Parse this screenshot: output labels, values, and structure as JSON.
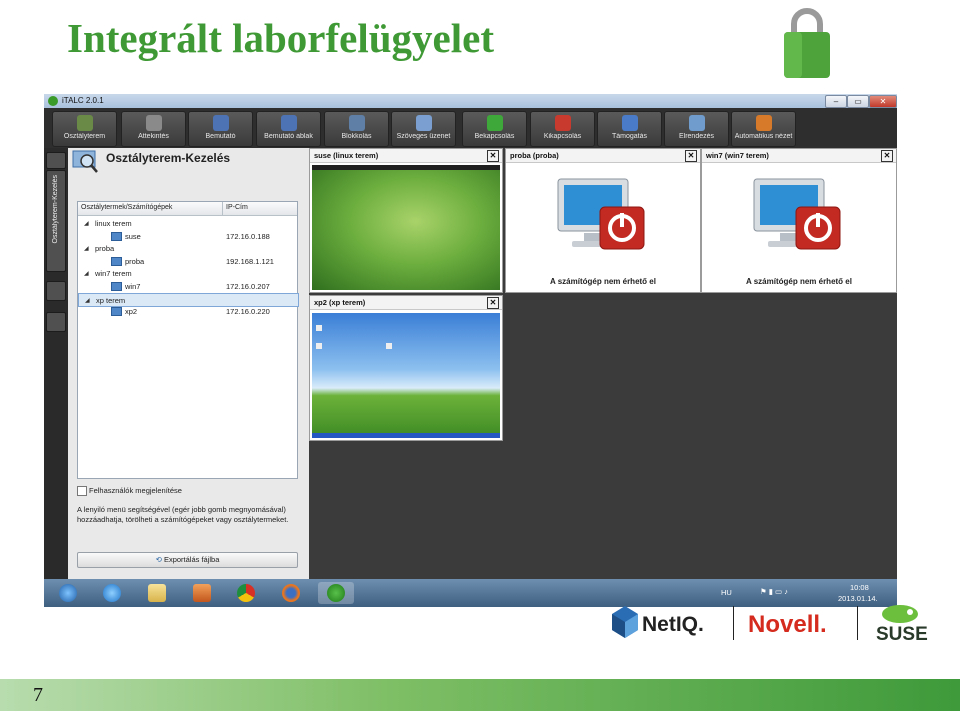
{
  "slide": {
    "title": "Integrált laborfelügyelet",
    "page_number": "7"
  },
  "app": {
    "title": "iTALC 2.0.1",
    "window_controls": [
      "minimize",
      "restore",
      "close"
    ],
    "toolbar": [
      {
        "label": "Osztályterem",
        "icon": "classroom-icon",
        "color": "#6a8b47"
      },
      {
        "label": "Áttekintés",
        "icon": "overview-icon",
        "color": "#8a8a8a"
      },
      {
        "label": "Bemutató",
        "icon": "demo-icon",
        "color": "#4e73b5"
      },
      {
        "label": "Bemutató ablak",
        "icon": "demo-window-icon",
        "color": "#4e73b5"
      },
      {
        "label": "Blokkolás",
        "icon": "lock-icon",
        "color": "#5f7fa6"
      },
      {
        "label": "Szöveges üzenet",
        "icon": "message-icon",
        "color": "#7a9fd0"
      },
      {
        "label": "Bekapcsolás",
        "icon": "power-on-icon",
        "color": "#3fa83a"
      },
      {
        "label": "Kikapcsolás",
        "icon": "power-off-icon",
        "color": "#c83a2e"
      },
      {
        "label": "Támogatás",
        "icon": "support-icon",
        "color": "#4a7bc8"
      },
      {
        "label": "Elrendezés",
        "icon": "arrange-icon",
        "color": "#6f9ccc"
      },
      {
        "label": "Automatikus nézet",
        "icon": "auto-view-icon",
        "color": "#d77a2a"
      }
    ],
    "sidebar_tab": "Osztályterem-Kezelés",
    "panel": {
      "title": "Osztályterem-Kezelés",
      "tree_headers": [
        "Osztálytermek/Számítógépek",
        "IP-Cím"
      ],
      "tree": [
        {
          "name": "linux terem",
          "type": "room",
          "ip": ""
        },
        {
          "name": "suse",
          "type": "computer",
          "ip": "172.16.0.188"
        },
        {
          "name": "proba",
          "type": "room",
          "ip": ""
        },
        {
          "name": "proba",
          "type": "computer",
          "ip": "192.168.1.121"
        },
        {
          "name": "win7 terem",
          "type": "room",
          "ip": ""
        },
        {
          "name": "win7",
          "type": "computer",
          "ip": "172.16.0.207"
        },
        {
          "name": "xp terem",
          "type": "room",
          "ip": "",
          "selected": true
        },
        {
          "name": "xp2",
          "type": "computer",
          "ip": "172.16.0.220"
        }
      ],
      "show_users_label": "Felhasználók megjelenítése",
      "help_text": "A lenyiló menü segítségével (egér jobb gomb megnyomásával) hozzáadhatja, törölheti a számítógépeket vagy osztálytermeket.",
      "export_label": "Exportálás fájlba"
    },
    "tiles": [
      {
        "title": "suse (linux terem)",
        "state": "online"
      },
      {
        "title": "proba (proba)",
        "state": "offline",
        "message": "A számítógép nem érhető el"
      },
      {
        "title": "win7 (win7 terem)",
        "state": "offline",
        "message": "A számítógép nem érhető el"
      },
      {
        "title": "xp2 (xp terem)",
        "state": "online"
      }
    ],
    "taskbar": {
      "lang": "HU",
      "time": "10:08",
      "date": "2013.01.14."
    }
  },
  "logos": {
    "netiq": "NetIQ.",
    "novell": "Novell.",
    "suse": "SUSE"
  }
}
